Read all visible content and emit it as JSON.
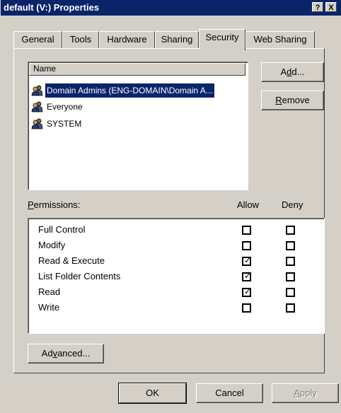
{
  "window": {
    "title": "default (V:) Properties",
    "help_button": "?",
    "close_button": "X"
  },
  "tabs": [
    {
      "label": "General",
      "active": false
    },
    {
      "label": "Tools",
      "active": false
    },
    {
      "label": "Hardware",
      "active": false
    },
    {
      "label": "Sharing",
      "active": false
    },
    {
      "label": "Security",
      "active": true
    },
    {
      "label": "Web Sharing",
      "active": false
    }
  ],
  "names_list": {
    "header": "Name",
    "items": [
      {
        "label": "Domain Admins (ENG-DOMAIN\\Domain A...",
        "icon": "group-icon",
        "selected": true
      },
      {
        "label": "Everyone",
        "icon": "group-icon",
        "selected": false
      },
      {
        "label": "SYSTEM",
        "icon": "group-icon",
        "selected": false
      }
    ]
  },
  "buttons": {
    "add": {
      "pre": "A",
      "ul": "d",
      "post": "d..."
    },
    "remove": {
      "pre": "",
      "ul": "R",
      "post": "emove"
    },
    "advanced": {
      "pre": "Ad",
      "ul": "v",
      "post": "anced..."
    },
    "ok": "OK",
    "cancel": "Cancel",
    "apply": {
      "pre": "",
      "ul": "A",
      "post": "pply"
    }
  },
  "permissions": {
    "label_ul": "P",
    "label_rest": "ermissions:",
    "allow_header": "Allow",
    "deny_header": "Deny",
    "rows": [
      {
        "name": "Full Control",
        "allow": false,
        "deny": false
      },
      {
        "name": "Modify",
        "allow": false,
        "deny": false
      },
      {
        "name": "Read & Execute",
        "allow": true,
        "deny": false
      },
      {
        "name": "List Folder Contents",
        "allow": true,
        "deny": false
      },
      {
        "name": "Read",
        "allow": true,
        "deny": false
      },
      {
        "name": "Write",
        "allow": false,
        "deny": false
      }
    ]
  },
  "colors": {
    "titlebar": "#0a246a",
    "selection": "#0a246a",
    "face": "#d4d0c8"
  }
}
